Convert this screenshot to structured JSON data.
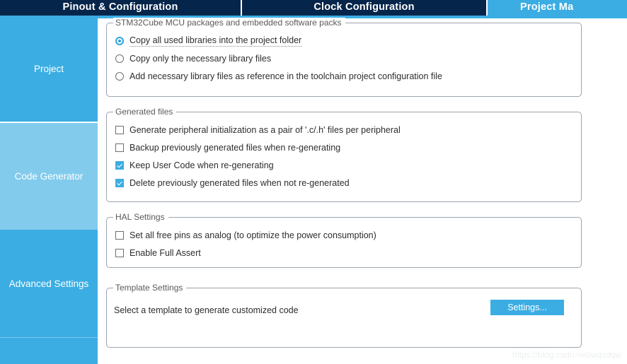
{
  "tabs": [
    {
      "label": "Pinout & Configuration",
      "selected": false
    },
    {
      "label": "Clock Configuration",
      "selected": false
    },
    {
      "label": "Project Ma",
      "selected": true
    }
  ],
  "sidebar": {
    "items": [
      {
        "label": "Project",
        "selected": false
      },
      {
        "label": "Code Generator",
        "selected": true
      },
      {
        "label": "Advanced Settings",
        "selected": false
      },
      {
        "label": "",
        "selected": false
      }
    ]
  },
  "groups": {
    "packages": {
      "title": "STM32Cube MCU packages and embedded software packs",
      "options": [
        {
          "label": "Copy all used libraries into the project folder",
          "checked": true,
          "focused": true
        },
        {
          "label": "Copy only the necessary library files",
          "checked": false,
          "focused": false
        },
        {
          "label": "Add necessary library files as reference in the toolchain project configuration file",
          "checked": false,
          "focused": false
        }
      ]
    },
    "generated": {
      "title": "Generated files",
      "options": [
        {
          "label": "Generate peripheral initialization as a pair of '.c/.h' files per peripheral",
          "checked": false
        },
        {
          "label": "Backup previously generated files when re-generating",
          "checked": false
        },
        {
          "label": "Keep User Code when re-generating",
          "checked": true
        },
        {
          "label": "Delete previously generated files when not re-generated",
          "checked": true
        }
      ]
    },
    "hal": {
      "title": "HAL Settings",
      "options": [
        {
          "label": "Set all free pins as analog (to optimize the power consumption)",
          "checked": false
        },
        {
          "label": "Enable Full Assert",
          "checked": false
        }
      ]
    },
    "template": {
      "title": "Template Settings",
      "description": "Select a template to generate customized code",
      "button_label": "Settings..."
    }
  },
  "watermark": "https://blog.csdn.net/wqsdqw",
  "colors": {
    "accent": "#3bade3",
    "tab_dark": "#06254b",
    "sidebar_selected": "#82cbec"
  }
}
